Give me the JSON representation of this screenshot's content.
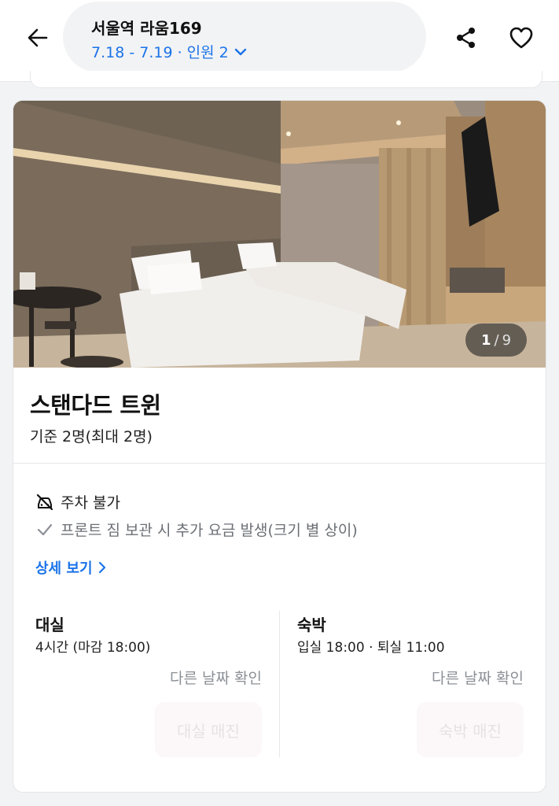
{
  "header": {
    "property_name": "서울역 라움169",
    "stay_summary": "7.18 - 7.19 · 인원 2",
    "icons": {
      "back": "arrow-left-icon",
      "dropdown": "chevron-down-icon",
      "share": "share-icon",
      "wishlist": "heart-icon"
    },
    "accent_color": "#1a73e8"
  },
  "room": {
    "photo_index": "1",
    "photo_separator": "/",
    "photo_total": "9",
    "name": "스탠다드 트윈",
    "capacity": "기준 2명(최대 2명)",
    "amenities": [
      {
        "icon": "no-parking-icon",
        "text": "주차 불가"
      },
      {
        "icon": "check-icon",
        "text": "프론트 짐 보관 시 추가 요금 발생(크기 별 상이)"
      }
    ],
    "detail_link": "상세 보기"
  },
  "options": [
    {
      "title": "대실",
      "time": "4시간 (마감 18:00)",
      "other_date": "다른 날짜 확인",
      "button": "대실 매진"
    },
    {
      "title": "숙박",
      "time": "입실 18:00 · 퇴실 11:00",
      "other_date": "다른 날짜 확인",
      "button": "숙박 매진"
    }
  ]
}
